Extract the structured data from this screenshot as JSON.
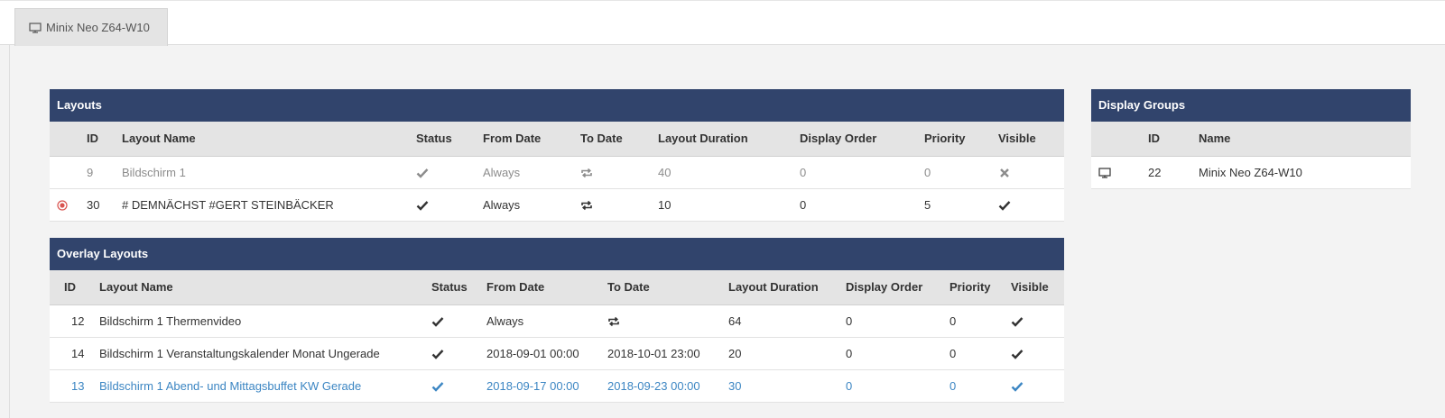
{
  "tab": {
    "label": "Minix Neo Z64-W10",
    "icon": "monitor-icon"
  },
  "layouts": {
    "title": "Layouts",
    "columns": [
      "ID",
      "Layout Name",
      "Status",
      "From Date",
      "To Date",
      "Layout Duration",
      "Display Order",
      "Priority",
      "Visible"
    ],
    "rows": [
      {
        "marker": "",
        "id": "9",
        "name": "Bildschirm 1",
        "status": "check",
        "from": "Always",
        "to": "repeat",
        "duration": "40",
        "order": "0",
        "priority": "0",
        "visible": "cross"
      },
      {
        "marker": "target",
        "id": "30",
        "name": "# DEMNÄCHST #GERT STEINBÄCKER",
        "status": "check",
        "from": "Always",
        "to": "repeat",
        "duration": "10",
        "order": "0",
        "priority": "5",
        "visible": "check"
      }
    ]
  },
  "overlay": {
    "title": "Overlay Layouts",
    "columns": [
      "ID",
      "Layout Name",
      "Status",
      "From Date",
      "To Date",
      "Layout Duration",
      "Display Order",
      "Priority",
      "Visible"
    ],
    "rows": [
      {
        "id": "12",
        "name": "Bildschirm 1 Thermenvideo",
        "status": "check",
        "from": "Always",
        "to": "repeat",
        "duration": "64",
        "order": "0",
        "priority": "0",
        "visible": "check"
      },
      {
        "id": "14",
        "name": "Bildschirm 1 Veranstaltungskalender Monat Ungerade",
        "status": "check",
        "from": "2018-09-01 00:00",
        "to": "2018-10-01 23:00",
        "duration": "20",
        "order": "0",
        "priority": "0",
        "visible": "check"
      },
      {
        "id": "13",
        "name": "Bildschirm 1 Abend- und Mittagsbuffet KW Gerade",
        "status": "check",
        "from": "2018-09-17 00:00",
        "to": "2018-09-23 00:00",
        "duration": "30",
        "order": "0",
        "priority": "0",
        "visible": "check"
      }
    ]
  },
  "groups": {
    "title": "Display Groups",
    "columns": [
      "ID",
      "Name"
    ],
    "rows": [
      {
        "icon": "monitor-icon",
        "id": "22",
        "name": "Minix Neo Z64-W10"
      }
    ]
  },
  "colors": {
    "header": "#31446c",
    "muted": "#8c8c8c",
    "highlight": "#3c86c3",
    "target": "#d9534f"
  }
}
